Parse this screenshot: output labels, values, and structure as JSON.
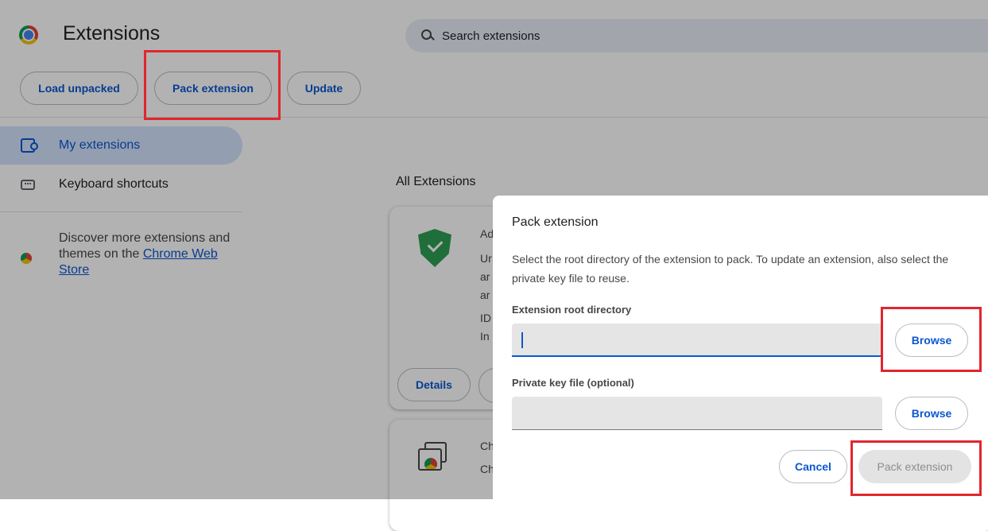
{
  "header": {
    "title": "Extensions",
    "search_placeholder": "Search extensions"
  },
  "toolbar": {
    "load_unpacked": "Load unpacked",
    "pack_extension": "Pack extension",
    "update": "Update"
  },
  "sidebar": {
    "items": [
      {
        "label": "My extensions",
        "icon": "puzzle-icon",
        "active": true
      },
      {
        "label": "Keyboard shortcuts",
        "icon": "keyboard-icon",
        "active": false
      }
    ],
    "discover_text": "Discover more extensions and themes on the ",
    "store_link": "Chrome Web Store"
  },
  "main": {
    "section_title": "All Extensions",
    "card1_lines": [
      "Ad",
      "Ur",
      "ar",
      "ar",
      "ID",
      "In"
    ],
    "card1_details": "Details",
    "card2_lines": [
      "Ch",
      "Ch"
    ]
  },
  "dialog": {
    "title": "Pack extension",
    "description": "Select the root directory of the extension to pack. To update an extension, also select the private key file to reuse.",
    "root_label": "Extension root directory",
    "root_value": "",
    "key_label": "Private key file (optional)",
    "key_value": "",
    "browse": "Browse",
    "cancel": "Cancel",
    "pack": "Pack extension"
  },
  "colors": {
    "accent": "#0b57d0",
    "highlight": "#e1262d",
    "active_nav_bg": "#d3e3fd"
  }
}
